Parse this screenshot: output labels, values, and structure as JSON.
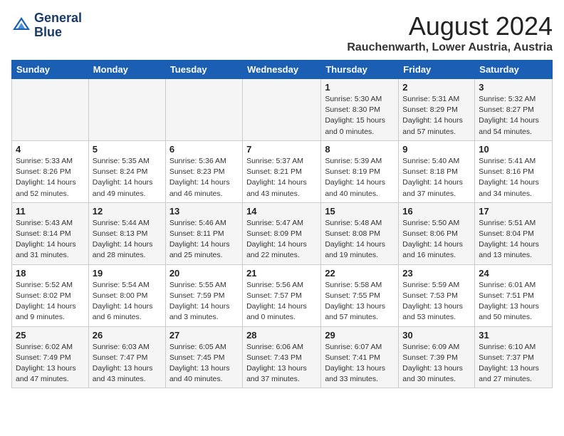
{
  "header": {
    "logo_line1": "General",
    "logo_line2": "Blue",
    "month": "August 2024",
    "location": "Rauchenwarth, Lower Austria, Austria"
  },
  "weekdays": [
    "Sunday",
    "Monday",
    "Tuesday",
    "Wednesday",
    "Thursday",
    "Friday",
    "Saturday"
  ],
  "weeks": [
    [
      {
        "day": "",
        "info": ""
      },
      {
        "day": "",
        "info": ""
      },
      {
        "day": "",
        "info": ""
      },
      {
        "day": "",
        "info": ""
      },
      {
        "day": "1",
        "info": "Sunrise: 5:30 AM\nSunset: 8:30 PM\nDaylight: 15 hours\nand 0 minutes."
      },
      {
        "day": "2",
        "info": "Sunrise: 5:31 AM\nSunset: 8:29 PM\nDaylight: 14 hours\nand 57 minutes."
      },
      {
        "day": "3",
        "info": "Sunrise: 5:32 AM\nSunset: 8:27 PM\nDaylight: 14 hours\nand 54 minutes."
      }
    ],
    [
      {
        "day": "4",
        "info": "Sunrise: 5:33 AM\nSunset: 8:26 PM\nDaylight: 14 hours\nand 52 minutes."
      },
      {
        "day": "5",
        "info": "Sunrise: 5:35 AM\nSunset: 8:24 PM\nDaylight: 14 hours\nand 49 minutes."
      },
      {
        "day": "6",
        "info": "Sunrise: 5:36 AM\nSunset: 8:23 PM\nDaylight: 14 hours\nand 46 minutes."
      },
      {
        "day": "7",
        "info": "Sunrise: 5:37 AM\nSunset: 8:21 PM\nDaylight: 14 hours\nand 43 minutes."
      },
      {
        "day": "8",
        "info": "Sunrise: 5:39 AM\nSunset: 8:19 PM\nDaylight: 14 hours\nand 40 minutes."
      },
      {
        "day": "9",
        "info": "Sunrise: 5:40 AM\nSunset: 8:18 PM\nDaylight: 14 hours\nand 37 minutes."
      },
      {
        "day": "10",
        "info": "Sunrise: 5:41 AM\nSunset: 8:16 PM\nDaylight: 14 hours\nand 34 minutes."
      }
    ],
    [
      {
        "day": "11",
        "info": "Sunrise: 5:43 AM\nSunset: 8:14 PM\nDaylight: 14 hours\nand 31 minutes."
      },
      {
        "day": "12",
        "info": "Sunrise: 5:44 AM\nSunset: 8:13 PM\nDaylight: 14 hours\nand 28 minutes."
      },
      {
        "day": "13",
        "info": "Sunrise: 5:46 AM\nSunset: 8:11 PM\nDaylight: 14 hours\nand 25 minutes."
      },
      {
        "day": "14",
        "info": "Sunrise: 5:47 AM\nSunset: 8:09 PM\nDaylight: 14 hours\nand 22 minutes."
      },
      {
        "day": "15",
        "info": "Sunrise: 5:48 AM\nSunset: 8:08 PM\nDaylight: 14 hours\nand 19 minutes."
      },
      {
        "day": "16",
        "info": "Sunrise: 5:50 AM\nSunset: 8:06 PM\nDaylight: 14 hours\nand 16 minutes."
      },
      {
        "day": "17",
        "info": "Sunrise: 5:51 AM\nSunset: 8:04 PM\nDaylight: 14 hours\nand 13 minutes."
      }
    ],
    [
      {
        "day": "18",
        "info": "Sunrise: 5:52 AM\nSunset: 8:02 PM\nDaylight: 14 hours\nand 9 minutes."
      },
      {
        "day": "19",
        "info": "Sunrise: 5:54 AM\nSunset: 8:00 PM\nDaylight: 14 hours\nand 6 minutes."
      },
      {
        "day": "20",
        "info": "Sunrise: 5:55 AM\nSunset: 7:59 PM\nDaylight: 14 hours\nand 3 minutes."
      },
      {
        "day": "21",
        "info": "Sunrise: 5:56 AM\nSunset: 7:57 PM\nDaylight: 14 hours\nand 0 minutes."
      },
      {
        "day": "22",
        "info": "Sunrise: 5:58 AM\nSunset: 7:55 PM\nDaylight: 13 hours\nand 57 minutes."
      },
      {
        "day": "23",
        "info": "Sunrise: 5:59 AM\nSunset: 7:53 PM\nDaylight: 13 hours\nand 53 minutes."
      },
      {
        "day": "24",
        "info": "Sunrise: 6:01 AM\nSunset: 7:51 PM\nDaylight: 13 hours\nand 50 minutes."
      }
    ],
    [
      {
        "day": "25",
        "info": "Sunrise: 6:02 AM\nSunset: 7:49 PM\nDaylight: 13 hours\nand 47 minutes."
      },
      {
        "day": "26",
        "info": "Sunrise: 6:03 AM\nSunset: 7:47 PM\nDaylight: 13 hours\nand 43 minutes."
      },
      {
        "day": "27",
        "info": "Sunrise: 6:05 AM\nSunset: 7:45 PM\nDaylight: 13 hours\nand 40 minutes."
      },
      {
        "day": "28",
        "info": "Sunrise: 6:06 AM\nSunset: 7:43 PM\nDaylight: 13 hours\nand 37 minutes."
      },
      {
        "day": "29",
        "info": "Sunrise: 6:07 AM\nSunset: 7:41 PM\nDaylight: 13 hours\nand 33 minutes."
      },
      {
        "day": "30",
        "info": "Sunrise: 6:09 AM\nSunset: 7:39 PM\nDaylight: 13 hours\nand 30 minutes."
      },
      {
        "day": "31",
        "info": "Sunrise: 6:10 AM\nSunset: 7:37 PM\nDaylight: 13 hours\nand 27 minutes."
      }
    ]
  ]
}
